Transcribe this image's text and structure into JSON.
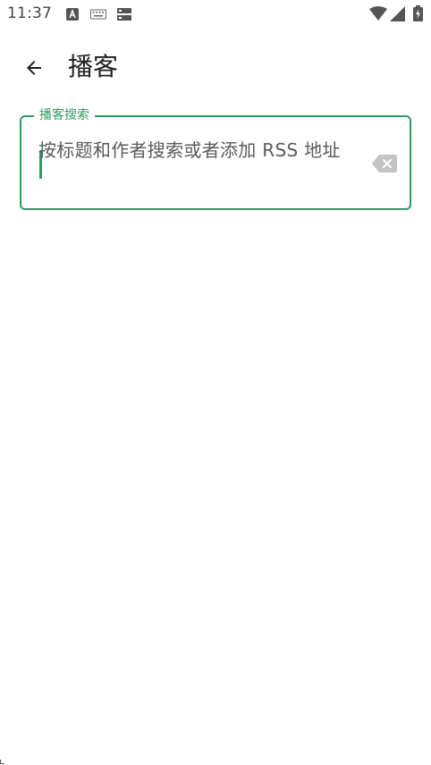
{
  "status_bar": {
    "time": "11:37",
    "icons": [
      "a-notification-icon",
      "keyboard-icon",
      "storage-icon",
      "wifi-icon",
      "cell-signal-icon",
      "battery-charging-icon"
    ]
  },
  "app_bar": {
    "back_icon": "arrow-back-icon",
    "title": "播客"
  },
  "search": {
    "label": "播客搜索",
    "placeholder": "按标题和作者搜索或者添加 RSS 地址",
    "value": "",
    "clear_icon": "backspace-clear-icon"
  },
  "colors": {
    "accent": "#2e9e5f",
    "text_primary": "#1f1f1f",
    "text_secondary": "#5a5a5a",
    "icon_gray": "#c4c4c4"
  }
}
